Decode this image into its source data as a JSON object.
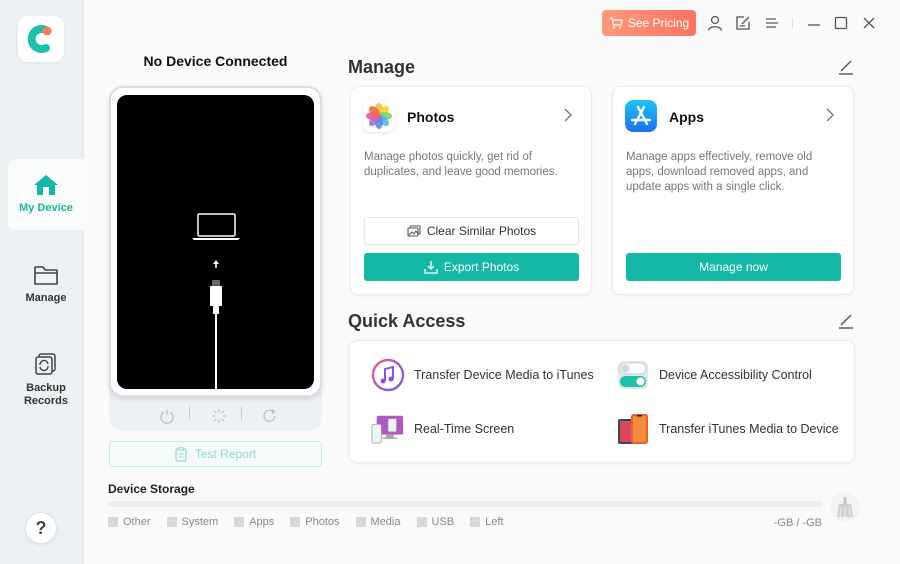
{
  "sidebar": {
    "items": [
      {
        "label": "My Device",
        "icon": "home-icon",
        "active": true
      },
      {
        "label": "Manage",
        "icon": "folder-icon",
        "active": false
      },
      {
        "label": "Backup\nRecords",
        "label_line1": "Backup",
        "label_line2": "Records",
        "icon": "backup-icon",
        "active": false
      }
    ],
    "help_label": "?"
  },
  "topbar": {
    "pricing_label": "See Pricing",
    "icons": [
      "account-icon",
      "feedback-icon",
      "menu-icon",
      "minimize-icon",
      "maximize-icon",
      "close-icon"
    ]
  },
  "device": {
    "title": "No Device Connected",
    "controls": [
      "power-icon",
      "loading-icon",
      "refresh-icon"
    ],
    "test_report_label": "Test Report"
  },
  "manage": {
    "title": "Manage",
    "cards": [
      {
        "title": "Photos",
        "description": "Manage photos quickly, get rid of duplicates, and leave good memories.",
        "secondary_button": "Clear Similar Photos",
        "primary_button": "Export Photos"
      },
      {
        "title": "Apps",
        "description": "Manage apps effectively, remove old apps, download removed apps, and update apps with a single click.",
        "primary_button": "Manage now"
      }
    ]
  },
  "quick_access": {
    "title": "Quick Access",
    "items": [
      {
        "label": "Transfer Device Media to iTunes",
        "icon": "itunes-icon"
      },
      {
        "label": "Device Accessibility Control",
        "icon": "toggle-icon"
      },
      {
        "label": "Real-Time Screen",
        "icon": "screen-mirror-icon"
      },
      {
        "label": "Transfer iTunes Media to Device",
        "icon": "phone-transfer-icon"
      }
    ]
  },
  "storage": {
    "title": "Device Storage",
    "legend": [
      "Other",
      "System",
      "Apps",
      "Photos",
      "Media",
      "USB",
      "Left"
    ],
    "total": "-GB / -GB",
    "used_fraction": 0
  },
  "colors": {
    "accent": "#13b8a6",
    "pricing": "#fb7460"
  }
}
